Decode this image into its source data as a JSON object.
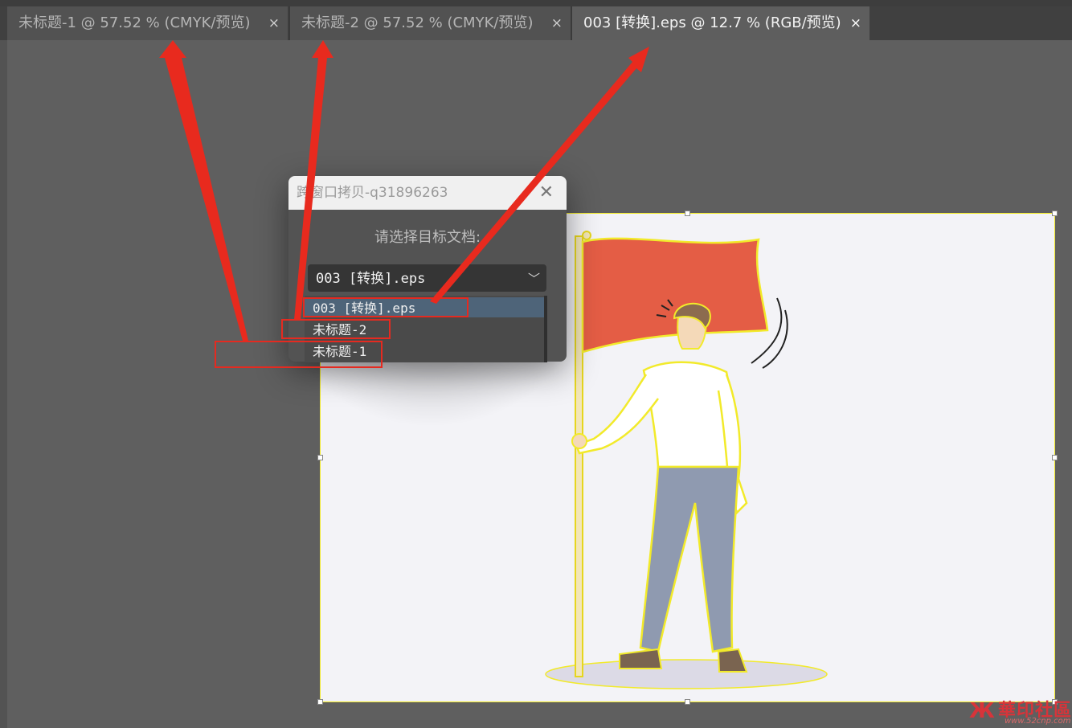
{
  "tabs": [
    {
      "label": "未标题-1 @ 57.52 % (CMYK/预览)",
      "close": "×",
      "active": false
    },
    {
      "label": "未标题-2 @ 57.52 % (CMYK/预览)",
      "close": "×",
      "active": false
    },
    {
      "label": "003 [转换].eps @ 12.7 % (RGB/预览)",
      "close": "×",
      "active": true
    }
  ],
  "dialog": {
    "title": "跨窗口拷贝-q31896263",
    "close_icon": "close-icon",
    "prompt": "请选择目标文档:",
    "selected_value": "003 [转换].eps",
    "options": [
      "003 [转换].eps",
      "未标题-2",
      "未标题-1"
    ]
  },
  "watermark": {
    "text": "華印社區",
    "url": "www.52cnp.com"
  },
  "colors": {
    "annotation_red": "#e52a20",
    "selection_yellow": "#f2ea2a",
    "flag_red": "#e45d45",
    "selected_option": "#4e6479"
  }
}
